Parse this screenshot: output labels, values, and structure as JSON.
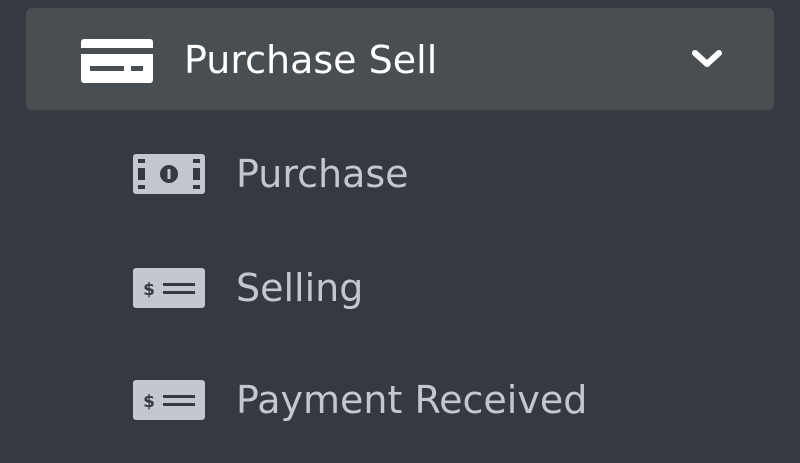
{
  "menu": {
    "header_label": "Purchase Sell",
    "header_icon": "money-check-icon",
    "expand_icon": "chevron-down-icon",
    "items": [
      {
        "label": "Purchase",
        "icon": "money-bill-icon"
      },
      {
        "label": "Selling",
        "icon": "money-check-dollar-icon"
      },
      {
        "label": "Payment Received",
        "icon": "money-check-dollar-icon"
      }
    ]
  },
  "colors": {
    "sidebar_bg": "#343a40",
    "active_header_bg": "#494e53",
    "header_text": "#ffffff",
    "item_text": "#c2c7d0"
  }
}
